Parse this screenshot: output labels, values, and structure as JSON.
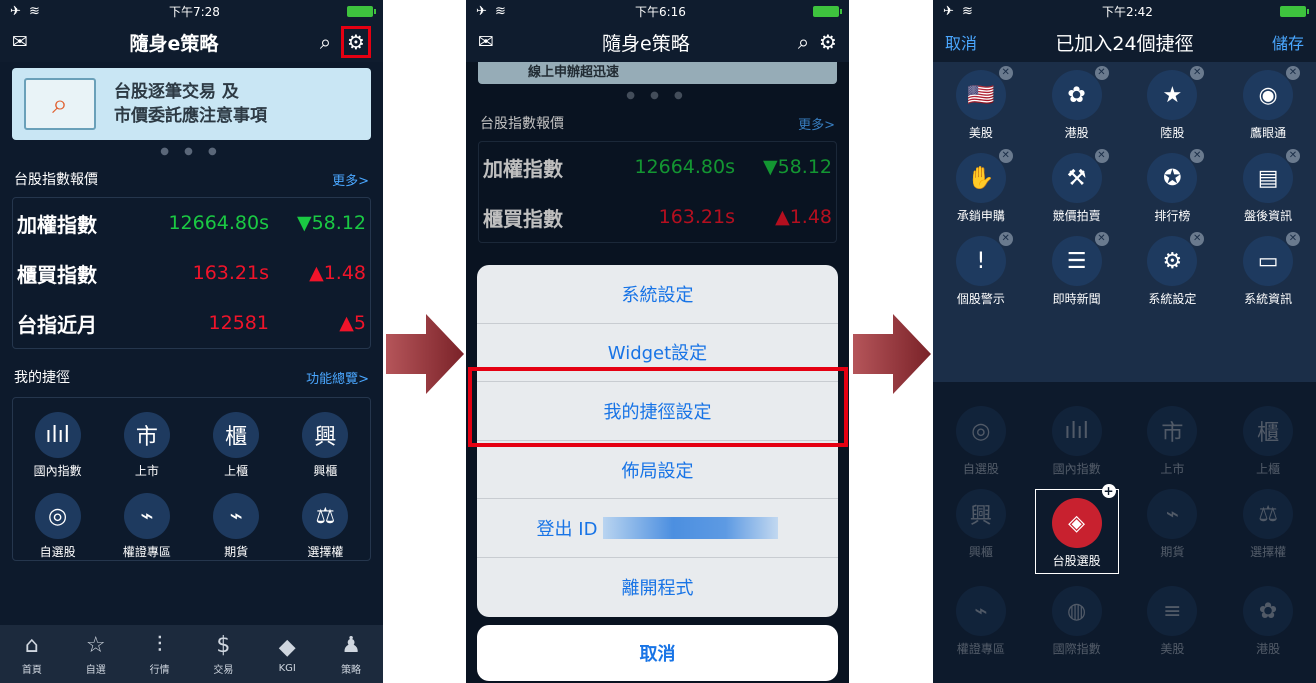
{
  "panel1": {
    "status": {
      "time": "下午7:28",
      "icons": "✈ ≋"
    },
    "nav": {
      "title": "隨身e策略"
    },
    "banner": {
      "line1": "台股逐筆交易 及",
      "line2": "市價委託應注意事項"
    },
    "quote_section": {
      "title": "台股指數報價",
      "more": "更多>"
    },
    "quotes": [
      {
        "name": "加權指數",
        "value": "12664.80s",
        "change": "▼58.12",
        "color": "green"
      },
      {
        "name": "櫃買指數",
        "value": "163.21s",
        "change": "▲1.48",
        "color": "red"
      },
      {
        "name": "台指近月",
        "value": "12581",
        "change": "▲5",
        "color": "red"
      }
    ],
    "shortcut_section": {
      "title": "我的捷徑",
      "more": "功能總覽>"
    },
    "shortcuts": [
      {
        "label": "國內指數",
        "glyph": "ılıl"
      },
      {
        "label": "上市",
        "glyph": "市"
      },
      {
        "label": "上櫃",
        "glyph": "櫃"
      },
      {
        "label": "興櫃",
        "glyph": "興"
      },
      {
        "label": "自選股",
        "glyph": "◎"
      },
      {
        "label": "權證專區",
        "glyph": "⌁"
      },
      {
        "label": "期貨",
        "glyph": "⌁"
      },
      {
        "label": "選擇權",
        "glyph": "⚖"
      }
    ],
    "tabs": [
      {
        "label": "首頁",
        "glyph": "⌂"
      },
      {
        "label": "自選",
        "glyph": "☆"
      },
      {
        "label": "行情",
        "glyph": "⫶"
      },
      {
        "label": "交易",
        "glyph": "$"
      },
      {
        "label": "KGI",
        "glyph": "◆"
      },
      {
        "label": "策略",
        "glyph": "♟"
      }
    ]
  },
  "panel2": {
    "status": {
      "time": "下午6:16",
      "icons": "✈ ≋"
    },
    "nav": {
      "title": "隨身e策略"
    },
    "banner_text": "線上申辦超迅速",
    "quote_section": {
      "title": "台股指數報價",
      "more": "更多>"
    },
    "quotes": [
      {
        "name": "加權指數",
        "value": "12664.80s",
        "change": "▼58.12",
        "color": "green"
      },
      {
        "name": "櫃買指數",
        "value": "163.21s",
        "change": "▲1.48",
        "color": "red"
      }
    ],
    "sheet": {
      "system": "系統設定",
      "widget": "Widget設定",
      "shortcut": "我的捷徑設定",
      "layout": "佈局設定",
      "logout": "登出 ID",
      "exit": "離開程式"
    },
    "cancel": "取消"
  },
  "panel3": {
    "status": {
      "time": "下午2:42",
      "icons": "✈ ≋"
    },
    "nav": {
      "cancel": "取消",
      "title": "已加入24個捷徑",
      "save": "儲存"
    },
    "selected": [
      {
        "label": "美股",
        "glyph": "🇺🇸"
      },
      {
        "label": "港股",
        "glyph": "✿"
      },
      {
        "label": "陸股",
        "glyph": "★"
      },
      {
        "label": "鷹眼通",
        "glyph": "◉"
      },
      {
        "label": "承銷申購",
        "glyph": "✋"
      },
      {
        "label": "競價拍賣",
        "glyph": "⚒"
      },
      {
        "label": "排行榜",
        "glyph": "✪"
      },
      {
        "label": "盤後資訊",
        "glyph": "▤"
      },
      {
        "label": "個股警示",
        "glyph": "!"
      },
      {
        "label": "即時新聞",
        "glyph": "☰"
      },
      {
        "label": "系統設定",
        "glyph": "⚙"
      },
      {
        "label": "系統資訊",
        "glyph": "▭"
      }
    ],
    "available": [
      {
        "label": "自選股",
        "glyph": "◎"
      },
      {
        "label": "國內指數",
        "glyph": "ılıl"
      },
      {
        "label": "上市",
        "glyph": "市"
      },
      {
        "label": "上櫃",
        "glyph": "櫃"
      },
      {
        "label": "興櫃",
        "glyph": "興"
      },
      {
        "label": "台股選股",
        "glyph": "◈"
      },
      {
        "label": "期貨",
        "glyph": "⌁"
      },
      {
        "label": "選擇權",
        "glyph": "⚖"
      },
      {
        "label": "權證專區",
        "glyph": "⌁"
      },
      {
        "label": "國際指數",
        "glyph": "◍"
      },
      {
        "label": "美股",
        "glyph": "≡"
      },
      {
        "label": "港股",
        "glyph": "✿"
      }
    ]
  },
  "colors": {
    "accent_red": "#e50012",
    "link_blue": "#4aa7ff",
    "up_red": "#f0142a",
    "down_green": "#1ac943"
  }
}
